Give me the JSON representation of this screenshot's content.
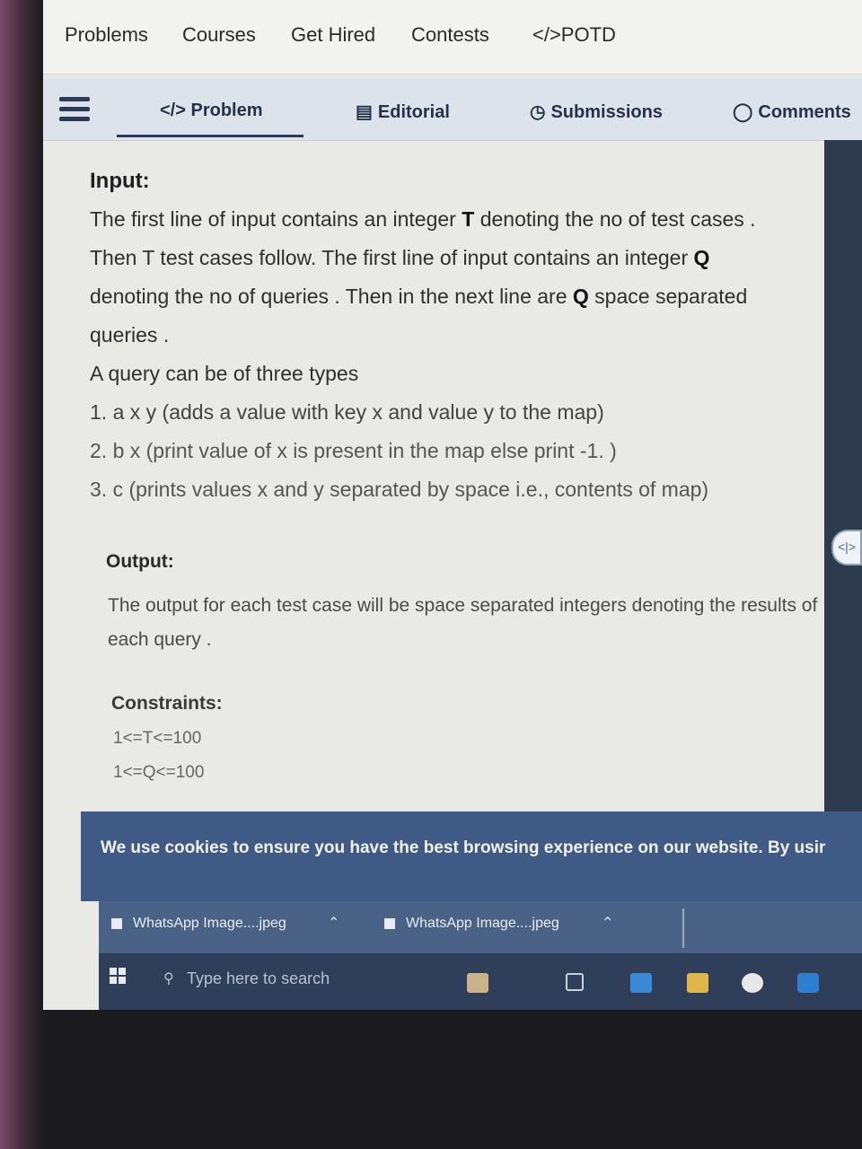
{
  "topnav": {
    "items": [
      "Problems",
      "Courses",
      "Get Hired",
      "Contests",
      "</>POTD"
    ]
  },
  "tabs": {
    "problem": "</> Problem",
    "editorial": "Editorial",
    "submissions": "Submissions",
    "comments": "Comments"
  },
  "content": {
    "input_heading": "Input:",
    "p1_a": "The first line of input contains an integer ",
    "p1_T": "T",
    "p1_b": " denoting the no of test cases .",
    "p2_a": "Then T test cases follow. The first line of input contains an integer ",
    "p2_Q": "Q",
    "p3_a": "denoting the no of queries . Then in the next line are ",
    "p3_Q": "Q",
    "p3_b": " space separated",
    "p4": "queries .",
    "p5": "A query can be of three types",
    "q1": "1. a x y (adds a value with key x and value y to the map)",
    "q2": "2. b x (print value of  x is present in the map else print -1. )",
    "q3": "3. c (prints values x and y separated by space i.e., contents of map)",
    "output_heading": "Output:",
    "output_text": "The output for each test case will  be space separated integers denoting the results of each query .",
    "constraints_heading": "Constraints:",
    "constraint_1": "1<=T<=100",
    "constraint_2": "1<=Q<=100"
  },
  "cookie_banner": {
    "text": "We use cookies to ensure you have the best browsing experience on our website. By usir"
  },
  "downloads": {
    "file_1": "WhatsApp Image....jpeg",
    "file_2": "WhatsApp Image....jpeg"
  },
  "taskbar": {
    "search_placeholder": "Type here to search"
  },
  "colors": {
    "cookie_bg": "#3f5a85",
    "tab_bg": "#dde3ea",
    "accent": "#2b3a55"
  }
}
